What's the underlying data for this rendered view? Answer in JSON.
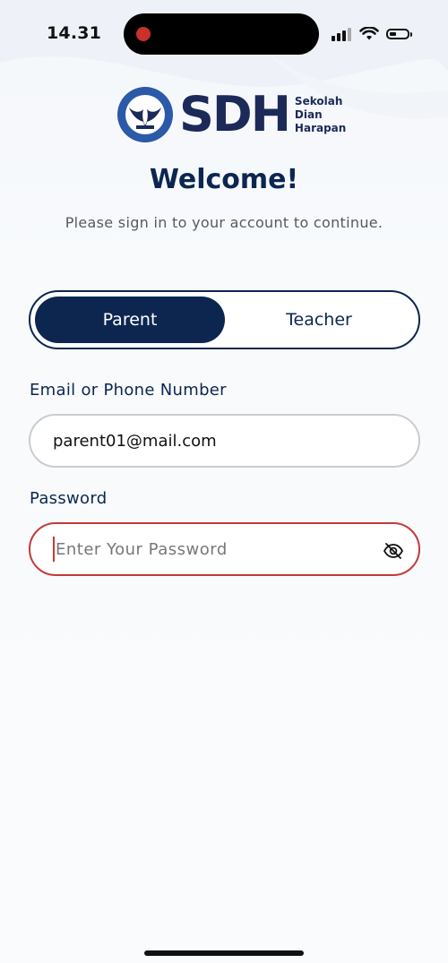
{
  "status_bar": {
    "time": "14.31"
  },
  "logo": {
    "abbr": "SDH",
    "name_line1": "Sekolah",
    "name_line2": "Dian",
    "name_line3": "Harapan"
  },
  "welcome": {
    "title": "Welcome!",
    "subtitle": "Please sign in to your account to continue."
  },
  "role_toggle": {
    "options": [
      "Parent",
      "Teacher"
    ],
    "selected": "Parent"
  },
  "form": {
    "email_label": "Email or Phone Number",
    "email_value": "parent01@mail.com",
    "password_label": "Password",
    "password_placeholder": "Enter Your Password"
  },
  "colors": {
    "primary": "#0c2650",
    "error_border": "#c33a3a",
    "background": "#f8fafc"
  },
  "icons": {
    "password_toggle": "eye-slash-icon"
  }
}
